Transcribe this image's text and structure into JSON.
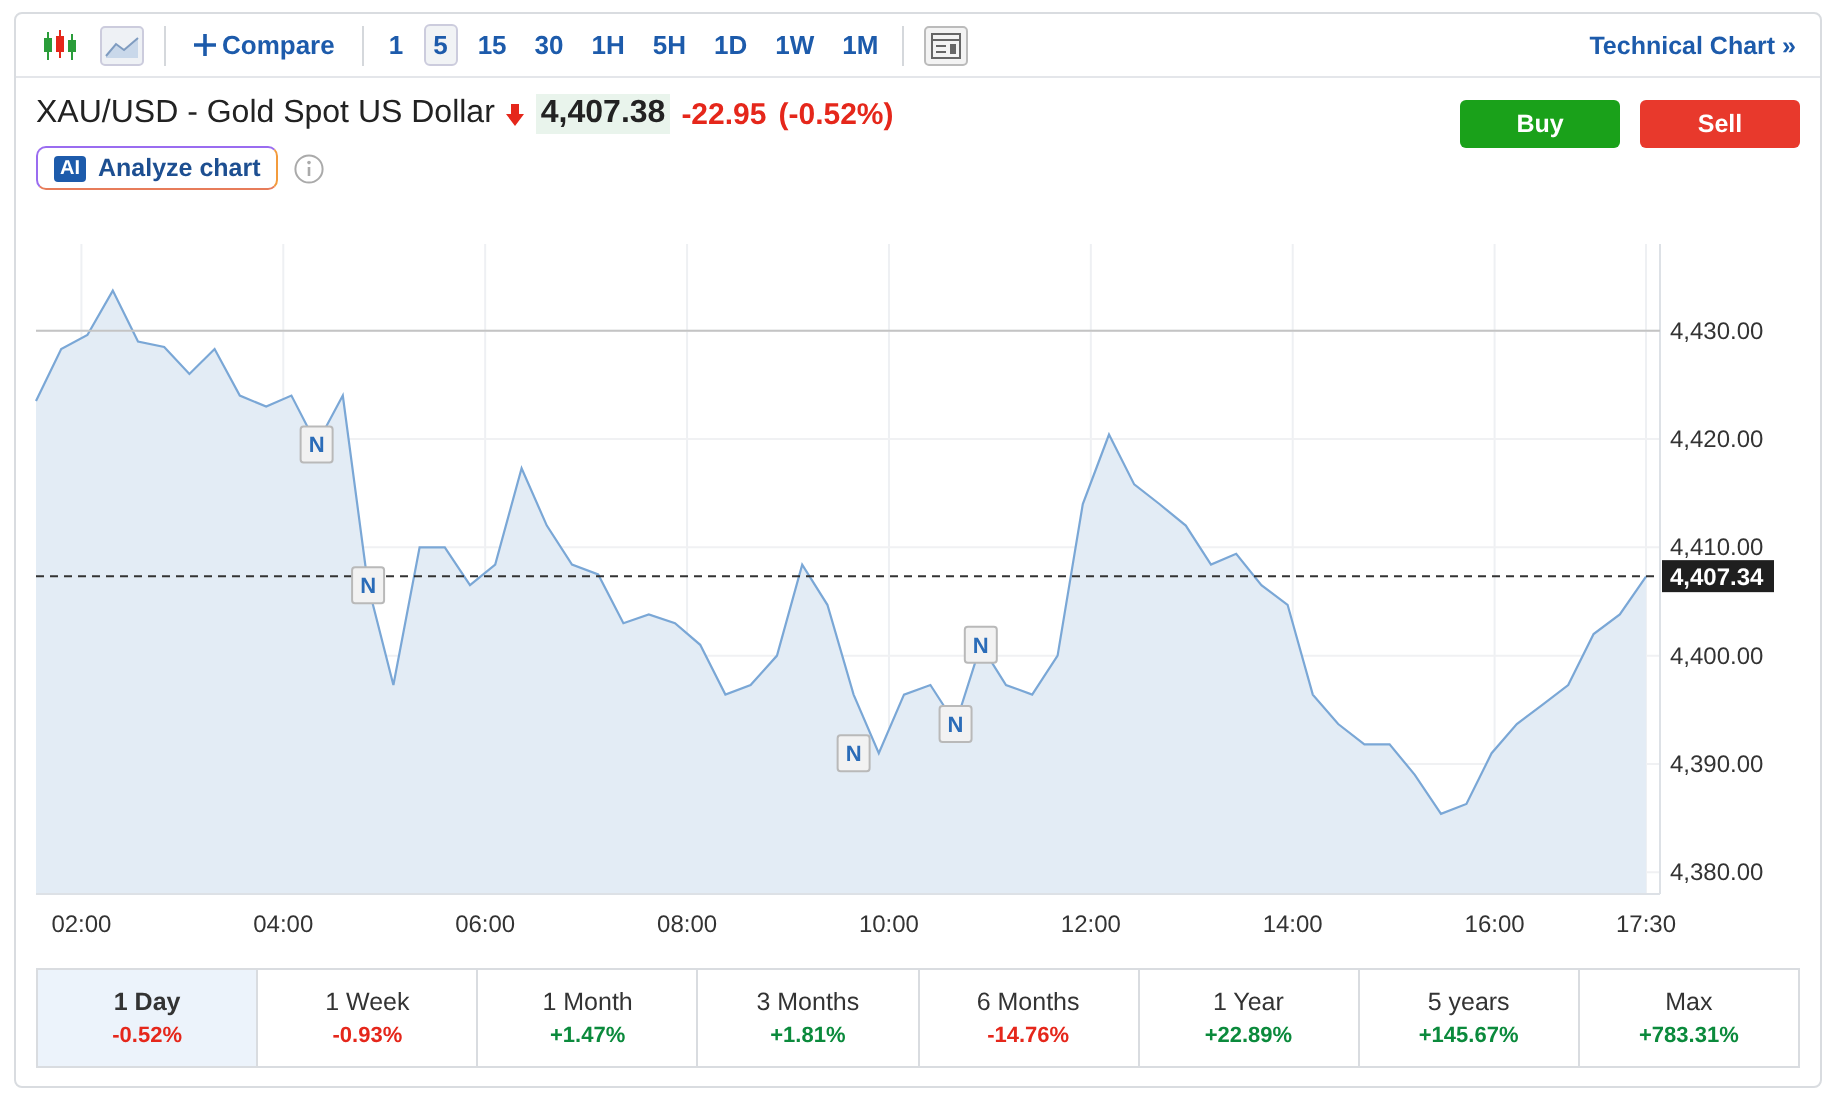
{
  "toolbar": {
    "intervals": [
      {
        "label": "1",
        "selected": false
      },
      {
        "label": "5",
        "selected": true
      },
      {
        "label": "15",
        "selected": false
      },
      {
        "label": "30",
        "selected": false
      },
      {
        "label": "1H",
        "selected": false
      },
      {
        "label": "5H",
        "selected": false
      },
      {
        "label": "1D",
        "selected": false
      },
      {
        "label": "1W",
        "selected": false
      },
      {
        "label": "1M",
        "selected": false
      }
    ],
    "compare": "Compare",
    "technical": "Technical Chart »"
  },
  "instrument": {
    "name": "XAU/USD - Gold Spot US Dollar",
    "color": "#e5271b",
    "price": "4,407.38",
    "change": "-22.95",
    "change_pct": "(-0.52%)"
  },
  "actions": [
    {
      "kind": "buy",
      "label": "Buy"
    },
    {
      "kind": "sell",
      "label": "Sell"
    }
  ],
  "analyze": {
    "badge": "AI",
    "label": "Analyze chart"
  },
  "chart": {
    "chart_data": {
      "type": "area",
      "grid": true,
      "xlim": [
        1.55,
        17.5
      ],
      "ylim": [
        4378,
        4438
      ],
      "x": [
        1.55,
        1.8,
        2.06,
        2.31,
        2.56,
        2.82,
        3.07,
        3.32,
        3.57,
        3.83,
        4.08,
        4.33,
        4.59,
        4.84,
        5.09,
        5.35,
        5.6,
        5.85,
        6.1,
        6.36,
        6.61,
        6.86,
        7.12,
        7.37,
        7.62,
        7.88,
        8.13,
        8.38,
        8.63,
        8.89,
        9.14,
        9.39,
        9.65,
        9.9,
        10.15,
        10.41,
        10.66,
        10.91,
        11.16,
        11.42,
        11.67,
        11.92,
        12.18,
        12.43,
        12.68,
        12.94,
        13.19,
        13.44,
        13.69,
        13.95,
        14.2,
        14.45,
        14.71,
        14.96,
        15.21,
        15.47,
        15.72,
        15.97,
        16.22,
        16.48,
        16.73,
        16.98,
        17.24,
        17.5
      ],
      "series": [
        {
          "color": "#7aa7d6",
          "values": [
            4423.5,
            4428.3,
            4429.6,
            4433.7,
            4429,
            4428.5,
            4426,
            4428.3,
            4424,
            4423,
            4424,
            4419.5,
            4424,
            4406.5,
            4397.3,
            4410,
            4410,
            4406.5,
            4408.4,
            4417.3,
            4412,
            4408.4,
            4407.5,
            4403,
            4403.8,
            4403,
            4401,
            4396.4,
            4397.3,
            4400,
            4408.4,
            4404.7,
            4396.4,
            4391,
            4396.4,
            4397.3,
            4393.7,
            4401,
            4397.3,
            4396.4,
            4400,
            4414,
            4420.4,
            4415.8,
            4414,
            4412,
            4408.4,
            4409.4,
            4406.5,
            4404.7,
            4396.4,
            4393.7,
            4391.8,
            4391.8,
            4389,
            4385.4,
            4386.3,
            4391,
            4393.7,
            4395.5,
            4397.3,
            4402,
            4403.8,
            4407.3
          ]
        }
      ],
      "xticks": [
        {
          "value": 2,
          "label": "02:00"
        },
        {
          "value": 4,
          "label": "04:00"
        },
        {
          "value": 6,
          "label": "06:00"
        },
        {
          "value": 8,
          "label": "08:00"
        },
        {
          "value": 10,
          "label": "10:00"
        },
        {
          "value": 12,
          "label": "12:00"
        },
        {
          "value": 14,
          "label": "14:00"
        },
        {
          "value": 16,
          "label": "16:00"
        },
        {
          "value": 17.5,
          "label": "17:30"
        }
      ],
      "yticks": [
        {
          "value": 4380,
          "label": "4,380.00"
        },
        {
          "value": 4390,
          "label": "4,390.00"
        },
        {
          "value": 4400,
          "label": "4,400.00"
        },
        {
          "value": 4410,
          "label": "4,410.00"
        },
        {
          "value": 4420,
          "label": "4,420.00"
        },
        {
          "value": 4430,
          "label": "4,430.00"
        }
      ],
      "ref_lines": [
        {
          "axis": "y",
          "value": 4430
        },
        {
          "axis": "y",
          "value": 4407.34,
          "label": "4,407.34"
        }
      ],
      "annotations": [
        {
          "text": "N",
          "x": 4.33,
          "y": 4419.5
        },
        {
          "text": "N",
          "x": 4.84,
          "y": 4406.5
        },
        {
          "text": "N",
          "x": 9.65,
          "y": 4391
        },
        {
          "text": "N",
          "x": 10.66,
          "y": 4393.7
        },
        {
          "text": "N",
          "x": 10.91,
          "y": 4401
        }
      ]
    }
  },
  "periods": [
    {
      "label": "1 Day",
      "change": "-0.52%",
      "color": "#e5271b",
      "selected": true
    },
    {
      "label": "1 Week",
      "change": "-0.93%",
      "color": "#e5271b",
      "selected": false
    },
    {
      "label": "1 Month",
      "change": "+1.47%",
      "color": "#0b8a3c",
      "selected": false
    },
    {
      "label": "3 Months",
      "change": "+1.81%",
      "color": "#0b8a3c",
      "selected": false
    },
    {
      "label": "6 Months",
      "change": "-14.76%",
      "color": "#e5271b",
      "selected": false
    },
    {
      "label": "1 Year",
      "change": "+22.89%",
      "color": "#0b8a3c",
      "selected": false
    },
    {
      "label": "5 years",
      "change": "+145.67%",
      "color": "#0b8a3c",
      "selected": false
    },
    {
      "label": "Max",
      "change": "+783.31%",
      "color": "#0b8a3c",
      "selected": false
    }
  ]
}
